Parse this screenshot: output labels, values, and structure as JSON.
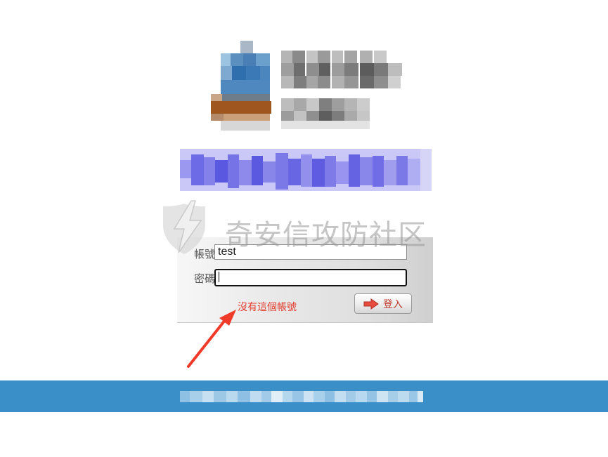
{
  "watermark": {
    "text": "奇安信攻防社区",
    "icon": "lightning-shield-icon"
  },
  "login": {
    "account_label": "帳號",
    "account_value": "test",
    "password_label": "密碼",
    "password_value": "",
    "error_message": "沒有這個帳號",
    "submit_label": "登入",
    "submit_icon": "arrow-right-icon"
  },
  "colors": {
    "footer_bar": "#3b8fc8",
    "error_text": "#e23b2e",
    "annotation_arrow": "#f03a2a"
  }
}
